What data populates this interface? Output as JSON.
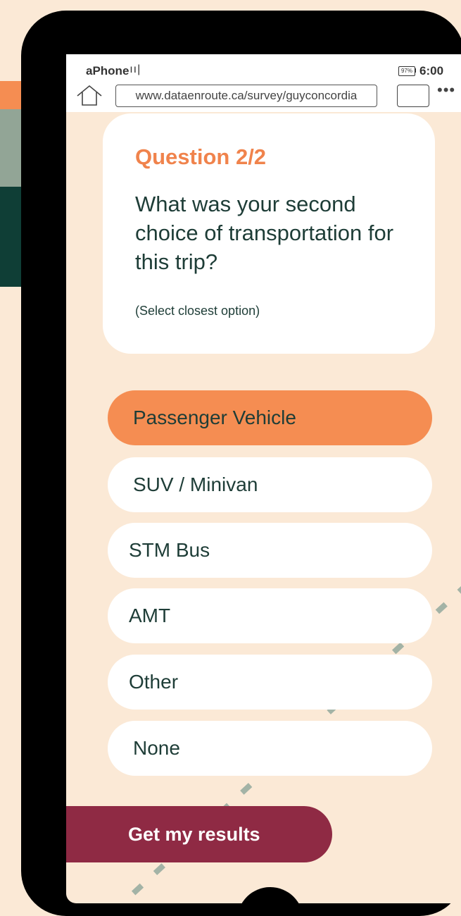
{
  "statusbar": {
    "carrier": "aPhone",
    "signal": " ıı|",
    "battery": "97%",
    "time": "6:00"
  },
  "browser": {
    "url": "www.dataenroute.ca/survey/guyconcordia",
    "more": "•••"
  },
  "question": {
    "title": "Question 2/2",
    "text": "What was your second choice of transportation for this trip?",
    "hint": "(Select closest option)"
  },
  "options": [
    {
      "label": "Passenger Vehicle",
      "selected": true
    },
    {
      "label": "SUV / Minivan",
      "selected": false
    },
    {
      "label": "STM Bus",
      "selected": false
    },
    {
      "label": "AMT",
      "selected": false
    },
    {
      "label": "Other",
      "selected": false
    },
    {
      "label": "None",
      "selected": false
    }
  ],
  "cta": {
    "label": "Get my results"
  },
  "colors": {
    "background": "#fbe9d6",
    "accent_orange": "#f58d52",
    "title_orange": "#f0834c",
    "cta_maroon": "#8f2a44",
    "text_dark_green": "#1e3d37",
    "bar_sage": "#92a596",
    "bar_dark_green": "#0f3e36"
  }
}
